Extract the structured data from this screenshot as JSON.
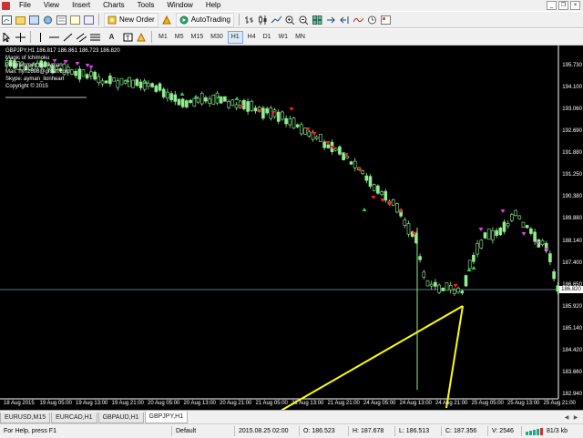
{
  "menu": [
    "File",
    "View",
    "Insert",
    "Charts",
    "Tools",
    "Window",
    "Help"
  ],
  "toolbar": {
    "new_order": "New Order",
    "autotrading": "AutoTrading",
    "timeframes": [
      "M1",
      "M5",
      "M15",
      "M30",
      "H1",
      "H4",
      "D1",
      "W1",
      "MN"
    ],
    "active_timeframe": "H1"
  },
  "chart": {
    "symbol_line": "GBPJPY,H1  186.817 186.861 186.723 186.820",
    "info_lines": [
      "Magic of Ichimoku",
      "Programmed by Ayman",
      "Mail: nyh1698@gmail.com",
      "Skype: ayman_lionheart",
      "Copyright © 2015"
    ],
    "current_price": "186.820",
    "y_labels": [
      "195.730",
      "194.100",
      "193.060",
      "192.690",
      "191.880",
      "191.250",
      "190.380",
      "189.880",
      "188.140",
      "187.400",
      "186.650",
      "185.920",
      "185.140",
      "184.420",
      "183.660",
      "182.940"
    ],
    "x_labels": [
      "18 Aug 2015",
      "19 Aug 05:00",
      "19 Aug 13:00",
      "19 Aug 21:00",
      "20 Aug 05:00",
      "20 Aug 13:00",
      "20 Aug 21:00",
      "21 Aug 05:00",
      "21 Aug 13:00",
      "21 Aug 21:00",
      "24 Aug 05:00",
      "24 Aug 13:00",
      "24 Aug 21:00",
      "25 Aug 05:00",
      "25 Aug 13:00",
      "25 Aug 21:00"
    ]
  },
  "tabs": [
    "EURUSD,M15",
    "EURCAD,H1",
    "GBPAUD,H1",
    "GBPJPY,H1"
  ],
  "active_tab": "GBPJPY,H1",
  "status": {
    "help": "For Help, press F1",
    "profile": "Default",
    "datetime": "2015.08.25 02:00",
    "open": "O: 186.523",
    "high": "H: 187.678",
    "low": "L: 186.513",
    "close": "C: 187.356",
    "volume": "V: 2546",
    "traffic": "81/3 kb"
  },
  "colors": {
    "chart_bg": "#000000",
    "candle": "#90ee90",
    "arrow_down": "#ff2020",
    "arrow_magenta": "#e040e0",
    "annotation": "#ffff00",
    "price_line": "#7f9db9"
  },
  "icons": [
    "new-chart-icon",
    "profiles-icon",
    "zoom-in-icon",
    "zoom-out-icon",
    "market-watch-icon",
    "navigator-icon",
    "terminal-icon",
    "strategy-tester-icon",
    "arrow-cursor-icon",
    "crosshair-icon",
    "vertical-line-icon",
    "horizontal-line-icon",
    "trendline-icon",
    "channel-icon",
    "fibonacci-icon",
    "text-icon",
    "label-icon",
    "shapes-icon",
    "bar-chart-icon",
    "candlestick-icon",
    "line-chart-icon",
    "period-icon",
    "template-icon"
  ]
}
